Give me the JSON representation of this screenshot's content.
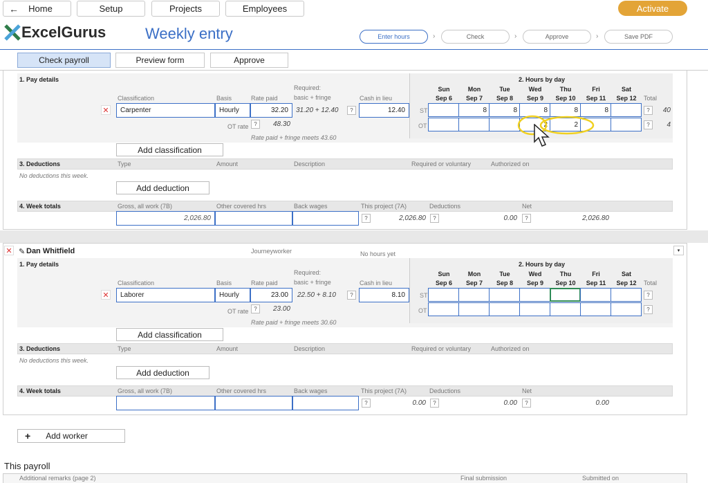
{
  "nav": {
    "home": "Home",
    "setup": "Setup",
    "projects": "Projects",
    "employees": "Employees",
    "activate": "Activate"
  },
  "brand": {
    "logo": "ExcelGurus",
    "page_title": "Weekly entry"
  },
  "steps": [
    "Enter hours",
    "Check",
    "Approve",
    "Save PDF"
  ],
  "tabs": [
    "Check payroll",
    "Preview form",
    "Approve"
  ],
  "labels": {
    "pay_details": "1. Pay details",
    "hours_by_day": "2. Hours by day",
    "deductions": "3. Deductions",
    "week_totals": "4. Week totals",
    "classification": "Classification",
    "basis": "Basis",
    "rate_paid": "Rate paid",
    "required": "Required:",
    "basic_fringe": "basic + fringe",
    "cash_in_lieu": "Cash in lieu",
    "ot_rate": "OT rate",
    "total": "Total",
    "st": "ST",
    "ot": "OT",
    "ded_type": "Type",
    "ded_amount": "Amount",
    "ded_desc": "Description",
    "ded_req": "Required or voluntary",
    "ded_auth": "Authorized on",
    "no_deductions": "No deductions this week.",
    "gross": "Gross, all work (7B)",
    "other_hrs": "Other covered hrs",
    "back_wages": "Back wages",
    "this_project": "This project (7A)",
    "wt_deductions": "Deductions",
    "net": "Net",
    "add_classification": "Add classification",
    "add_deduction": "Add deduction",
    "add_worker": "Add worker",
    "q": "?"
  },
  "days": [
    {
      "d": "Sun",
      "date": "Sep 6"
    },
    {
      "d": "Mon",
      "date": "Sep 7"
    },
    {
      "d": "Tue",
      "date": "Sep 8"
    },
    {
      "d": "Wed",
      "date": "Sep 9"
    },
    {
      "d": "Thu",
      "date": "Sep 10"
    },
    {
      "d": "Fri",
      "date": "Sep 11"
    },
    {
      "d": "Sat",
      "date": "Sep 12"
    }
  ],
  "worker1": {
    "classification": "Carpenter",
    "basis": "Hourly",
    "rate_paid": "32.20",
    "required": "31.20 + 12.40",
    "cash_in_lieu": "12.40",
    "ot_rate": "48.30",
    "meets_note": "Rate paid + fringe meets 43.60",
    "st_hours": [
      "",
      "8",
      "8",
      "8",
      "8",
      "8",
      ""
    ],
    "ot_hours": [
      "",
      "",
      "",
      "2",
      "2",
      "",
      ""
    ],
    "st_total": "40",
    "ot_total": "4",
    "gross": "2,026.80",
    "this_project": "2,026.80",
    "deductions": "0.00",
    "net": "2,026.80"
  },
  "worker2": {
    "name": "Dan Whitfield",
    "role": "Journeyworker",
    "status": "No hours yet",
    "classification": "Laborer",
    "basis": "Hourly",
    "rate_paid": "23.00",
    "required": "22.50 + 8.10",
    "cash_in_lieu": "8.10",
    "ot_rate": "23.00",
    "meets_note": "Rate paid + fringe meets 30.60",
    "this_project": "0.00",
    "deductions": "0.00",
    "net": "0.00"
  },
  "footer": {
    "this_payroll": "This payroll",
    "remarks": "Additional remarks (page 2)",
    "final_submission": "Final submission",
    "submitted_on": "Submitted on"
  },
  "colors": {
    "accent": "#3b6fc6",
    "activate": "#e3a437",
    "highlight": "#f0d020"
  }
}
